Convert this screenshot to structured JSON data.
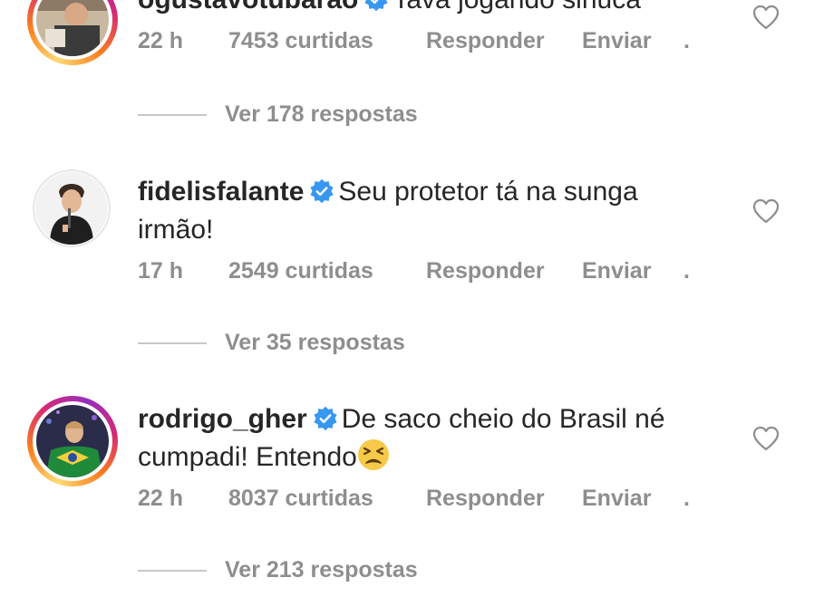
{
  "colors": {
    "text": "#262626",
    "muted": "#8e8e8e",
    "verified_blue": "#3897f0",
    "divider": "#c7c7c7"
  },
  "comments": [
    {
      "username": "ogustavotubarao",
      "text": "Tava jogando sinuca",
      "time": "22 h",
      "likes": "7453 curtidas",
      "reply": "Responder",
      "send": "Enviar",
      "more": ".",
      "replies": "Ver 178 respostas",
      "story_ring": true
    },
    {
      "username": "fidelisfalante",
      "text": "Seu protetor tá na sunga irmão!",
      "time": "17 h",
      "likes": "2549 curtidas",
      "reply": "Responder",
      "send": "Enviar",
      "more": ".",
      "replies": "Ver 35 respostas",
      "story_ring": false
    },
    {
      "username": "rodrigo_gher",
      "text": "De saco cheio do Brasil né cumpadi! Entendo",
      "emoji": "tired-face-emoji",
      "time": "22 h",
      "likes": "8037 curtidas",
      "reply": "Responder",
      "send": "Enviar",
      "more": ".",
      "replies": "Ver 213 respostas",
      "story_ring": true
    }
  ]
}
